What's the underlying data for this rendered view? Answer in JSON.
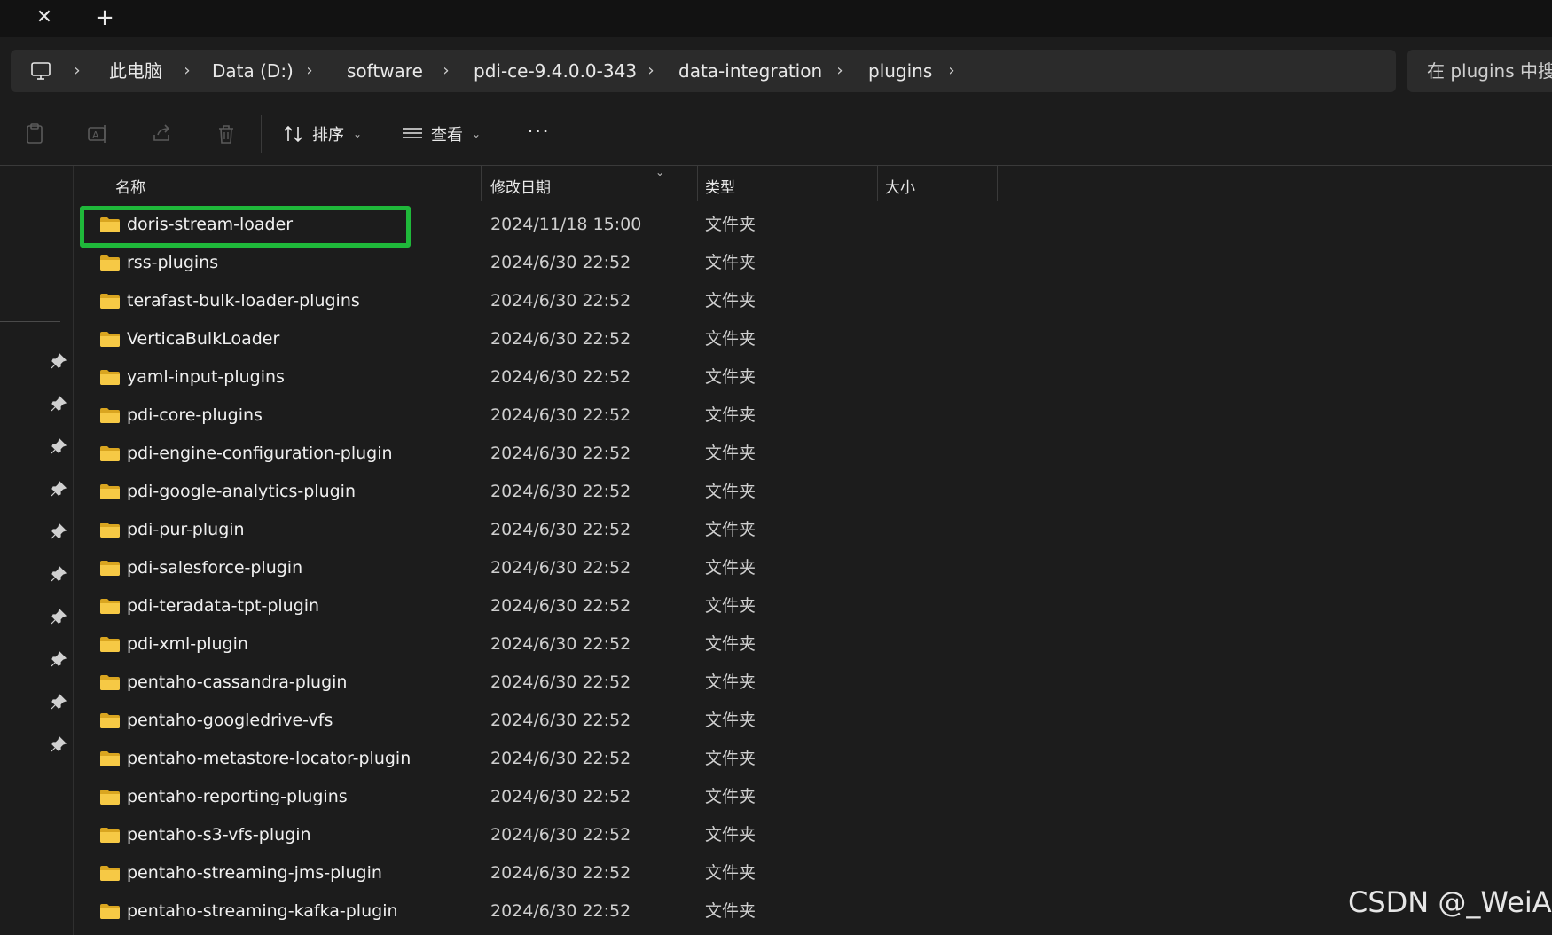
{
  "tabbar": {
    "close_glyph": "✕",
    "new_tab_glyph": "+"
  },
  "address": {
    "icon": "this-pc-icon",
    "separator": "›",
    "crumbs": [
      "此电脑",
      "Data (D:)",
      "software",
      "pdi-ce-9.4.0.0-343",
      "data-integration",
      "plugins"
    ]
  },
  "search": {
    "placeholder": "在 plugins 中搜"
  },
  "toolbar": {
    "icons": [
      "paste-icon",
      "rename-icon",
      "share-icon",
      "delete-icon"
    ],
    "sort_label": "排序",
    "view_label": "查看",
    "more_label": "···"
  },
  "columns": {
    "name": "名称",
    "date": "修改日期",
    "type": "类型",
    "size": "大小"
  },
  "rows": [
    {
      "name": "doris-stream-loader",
      "date": "2024/11/18 15:00",
      "type": "文件夹",
      "highlighted": true
    },
    {
      "name": "rss-plugins",
      "date": "2024/6/30 22:52",
      "type": "文件夹"
    },
    {
      "name": "terafast-bulk-loader-plugins",
      "date": "2024/6/30 22:52",
      "type": "文件夹"
    },
    {
      "name": "VerticaBulkLoader",
      "date": "2024/6/30 22:52",
      "type": "文件夹"
    },
    {
      "name": "yaml-input-plugins",
      "date": "2024/6/30 22:52",
      "type": "文件夹"
    },
    {
      "name": "pdi-core-plugins",
      "date": "2024/6/30 22:52",
      "type": "文件夹"
    },
    {
      "name": "pdi-engine-configuration-plugin",
      "date": "2024/6/30 22:52",
      "type": "文件夹"
    },
    {
      "name": "pdi-google-analytics-plugin",
      "date": "2024/6/30 22:52",
      "type": "文件夹"
    },
    {
      "name": "pdi-pur-plugin",
      "date": "2024/6/30 22:52",
      "type": "文件夹"
    },
    {
      "name": "pdi-salesforce-plugin",
      "date": "2024/6/30 22:52",
      "type": "文件夹"
    },
    {
      "name": "pdi-teradata-tpt-plugin",
      "date": "2024/6/30 22:52",
      "type": "文件夹"
    },
    {
      "name": "pdi-xml-plugin",
      "date": "2024/6/30 22:52",
      "type": "文件夹"
    },
    {
      "name": "pentaho-cassandra-plugin",
      "date": "2024/6/30 22:52",
      "type": "文件夹"
    },
    {
      "name": "pentaho-googledrive-vfs",
      "date": "2024/6/30 22:52",
      "type": "文件夹"
    },
    {
      "name": "pentaho-metastore-locator-plugin",
      "date": "2024/6/30 22:52",
      "type": "文件夹"
    },
    {
      "name": "pentaho-reporting-plugins",
      "date": "2024/6/30 22:52",
      "type": "文件夹"
    },
    {
      "name": "pentaho-s3-vfs-plugin",
      "date": "2024/6/30 22:52",
      "type": "文件夹"
    },
    {
      "name": "pentaho-streaming-jms-plugin",
      "date": "2024/6/30 22:52",
      "type": "文件夹"
    },
    {
      "name": "pentaho-streaming-kafka-plugin",
      "date": "2024/6/30 22:52",
      "type": "文件夹"
    }
  ],
  "nav": {
    "pin_icon": "pin-icon",
    "pin_count": 10
  },
  "colors": {
    "background": "#1c1c1c",
    "highlight": "#1fb83a",
    "folder": "#f4c542"
  },
  "watermark": "CSDN @_WeiA"
}
